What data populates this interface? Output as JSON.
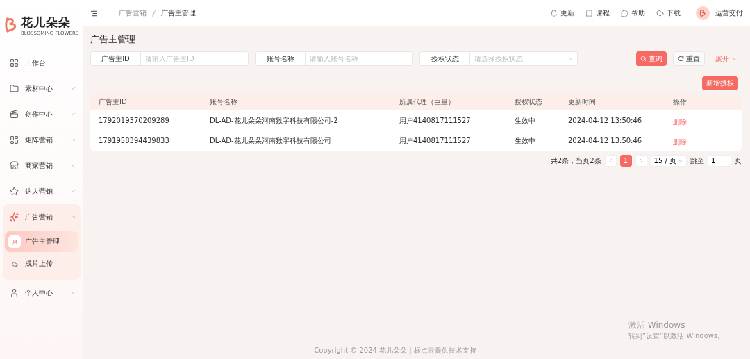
{
  "logo": {
    "name": "花儿朵朵",
    "tagline": "BLOSSOMING FLOWERS"
  },
  "sidebar": {
    "items": [
      {
        "label": "工作台",
        "kind": "link"
      },
      {
        "label": "素材中心",
        "kind": "group",
        "expanded": false
      },
      {
        "label": "创作中心",
        "kind": "group",
        "expanded": false
      },
      {
        "label": "矩阵营销",
        "kind": "group",
        "expanded": false
      },
      {
        "label": "商家营销",
        "kind": "group",
        "expanded": false
      },
      {
        "label": "达人营销",
        "kind": "group",
        "expanded": false
      },
      {
        "label": "广告营销",
        "kind": "group",
        "expanded": true,
        "children": [
          {
            "label": "广告主管理",
            "selected": true
          },
          {
            "label": "成片上传",
            "selected": false
          }
        ]
      },
      {
        "label": "个人中心",
        "kind": "group",
        "expanded": false
      }
    ]
  },
  "breadcrumb": [
    "广告营销",
    "广告主管理"
  ],
  "header_actions": [
    "更新",
    "课程",
    "帮助",
    "下载"
  ],
  "user": {
    "name": "运营交付"
  },
  "page_title": "广告主管理",
  "filters": [
    {
      "label": "广告主ID",
      "placeholder": "请输入广告主ID",
      "kind": "input"
    },
    {
      "label": "账号名称",
      "placeholder": "请输入账号名称",
      "kind": "input"
    },
    {
      "label": "授权状态",
      "placeholder": "请选择授权状态",
      "kind": "select"
    }
  ],
  "filter_buttons": [
    {
      "label": "查询",
      "kind": "primary"
    },
    {
      "label": "重置",
      "kind": "default"
    },
    {
      "label": "展开",
      "kind": "link"
    }
  ],
  "add_button": "新增授权",
  "table": {
    "columns": [
      "广告主ID",
      "账号名称",
      "所属代理（巨量）",
      "授权状态",
      "更新时间",
      "操作"
    ],
    "rows": [
      {
        "cells": [
          "1792019370209289",
          "DL-AD-花儿朵朵河南数字科技有限公司-2",
          "用户4140817111527",
          "生效中",
          "2024-04-12 13:50:46"
        ],
        "action": "删除"
      },
      {
        "cells": [
          "1791958394439833",
          "DL-AD-花儿朵朵河南数字科技有限公司",
          "用户4140817111527",
          "生效中",
          "2024-04-12 13:50:46"
        ],
        "action": "删除"
      }
    ]
  },
  "pagination": {
    "summary": "共2条，当页2条",
    "pages": [
      {
        "label": "1",
        "selected": true
      }
    ],
    "page_size": "15 / 页",
    "jump_label": "跳至",
    "jump_value": "1",
    "page_suffix": "页"
  },
  "footer": "Copyright © 2024 花儿朵朵 | 标点云提供技术支持",
  "os_notice": {
    "title": "激活 Windows",
    "subtitle": "转到“设置”以激活 Windows。"
  }
}
